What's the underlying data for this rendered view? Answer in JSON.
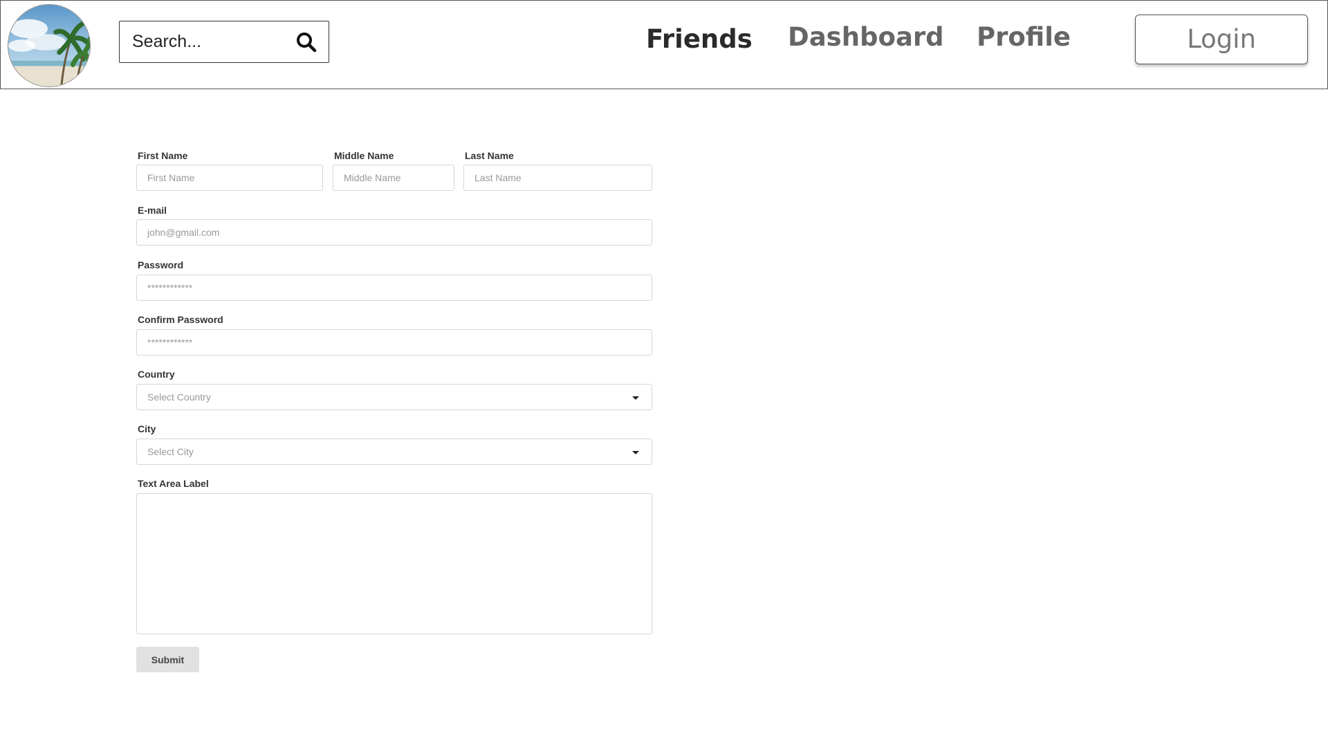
{
  "header": {
    "logo_alt": "beach-with-palm-trees",
    "search": {
      "placeholder": "Search..."
    },
    "nav": {
      "friends": "Friends",
      "dashboard": "Dashboard",
      "profile": "Profile"
    },
    "login_label": "Login"
  },
  "form": {
    "first_name": {
      "label": "First Name",
      "placeholder": "First Name",
      "value": ""
    },
    "middle_name": {
      "label": "Middle Name",
      "placeholder": "Middle Name",
      "value": ""
    },
    "last_name": {
      "label": "Last Name",
      "placeholder": "Last Name",
      "value": ""
    },
    "email": {
      "label": "E-mail",
      "placeholder": "john@gmail.com",
      "value": ""
    },
    "password": {
      "label": "Password",
      "placeholder": "************",
      "value": ""
    },
    "confirm_password": {
      "label": "Confirm Password",
      "placeholder": "************",
      "value": ""
    },
    "country": {
      "label": "Country",
      "selected": "Select Country"
    },
    "city": {
      "label": "City",
      "selected": "Select City"
    },
    "textarea": {
      "label": "Text Area Label",
      "value": ""
    },
    "submit_label": "Submit"
  },
  "icons": {
    "search": "search-icon",
    "dropdown": "chevron-down-icon"
  }
}
